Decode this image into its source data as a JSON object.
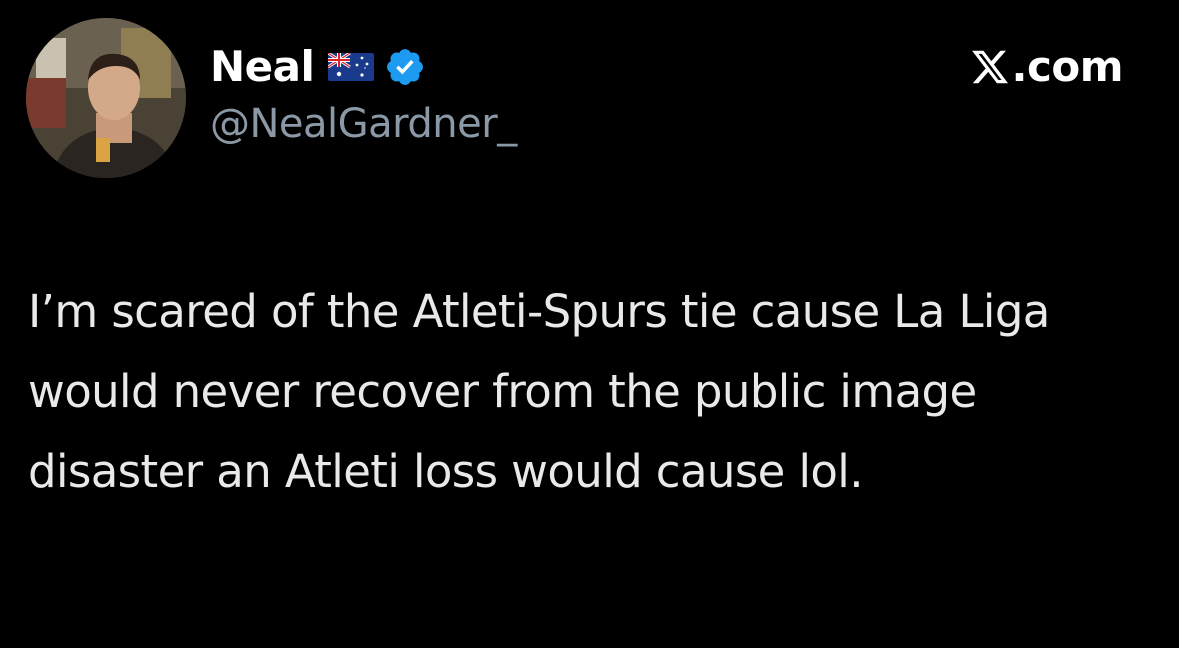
{
  "tweet": {
    "display_name": "Neal",
    "flag_icon": "australia-flag-emoji",
    "verified_icon": "verified-badge-icon",
    "handle": "@NealGardner_",
    "brand_icon": "x-logo-icon",
    "brand_text": ".com",
    "text": "I’m scared of the Atleti-Spurs tie cause La Liga would never recover from the public image disaster an Atleti loss would cause lol."
  },
  "colors": {
    "background": "#000000",
    "name": "#ffffff",
    "handle": "#8b98a5",
    "body_text": "#e7e9ea",
    "verified": "#1d9bf0"
  }
}
